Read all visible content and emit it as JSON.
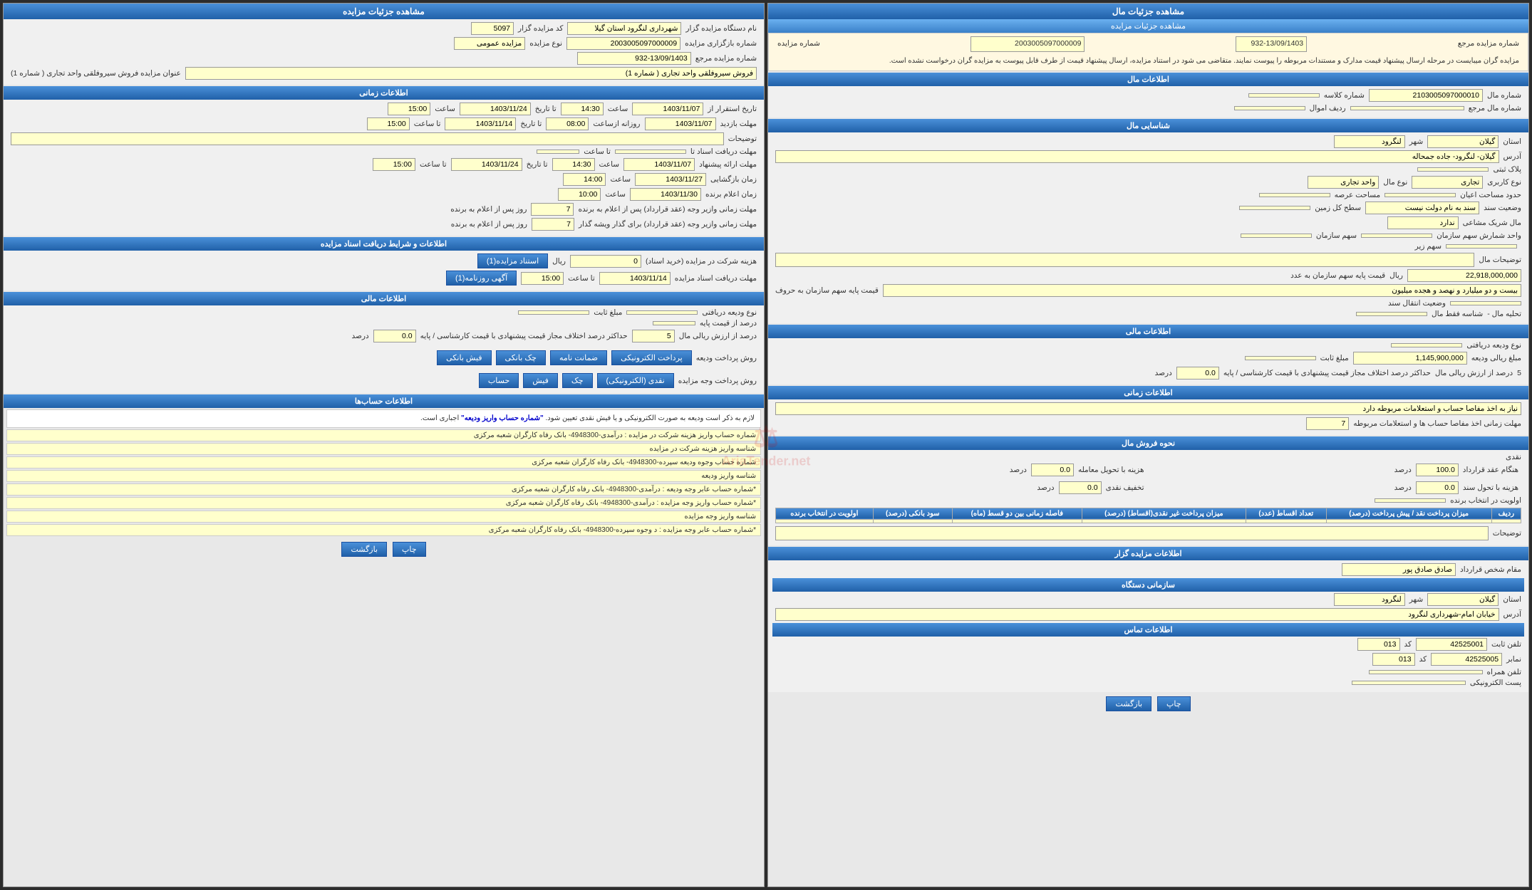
{
  "leftPanel": {
    "title": "مشاهده جزئیات مال",
    "subHeader": "مشاهده جزئیات مزایده",
    "notice": "مزایده گران میبایست در مرحله ارسال پیشنهاد قیمت مدارک و مستندات مربوطه را پیوست نمایند. متقاضی می شود در استناد مزایده، ارسال پیشنهاد قیمت از طرف قابل پیوست به مزایده گران درخواست نشده است.",
    "auctionCode": "2003005097000009",
    "auctionRef": "932-13/09/1403",
    "malInfo": {
      "sectionTitle": "اطلاعات مال",
      "malNumber": "2103005097000010",
      "malMarja": "",
      "classNumber": "",
      "redifAmval": "",
      "shenasiMali": {
        "sectionTitle": "شناسایی مال",
        "ostan": "گیلان",
        "shahr": "لنگرود",
        "address": "گیلان- لنگرود- جاده جمحاله",
        "plakSabti": "",
        "noKarbari": "تجاری",
        "noMal": "واحد تجاری",
        "hodudMosahat": "",
        "masahatArsa": "",
        "sathKolZamin": "",
        "malSharekMoshae": "ندارد",
        "vaziatSanad": "سند به نام دولت نیست",
        "vadSahmSazman": "",
        "sahmSazman": "",
        "sahmZir": "",
        "tozihatMal": "",
        "gheymatPayeSaham": "22,918,000,000",
        "gheymatUnit": "ریال",
        "payeSahamText": "بیست و دو میلیارد و نهصد و هجده میلیون",
        "vaziatEntegalSanad": "",
        "tahliyeMal": "تحلیه مال -"
      }
    },
    "maliInfo": {
      "sectionTitle": "اطلاعات مالی",
      "noeVadiye": "",
      "mablaghRialiVadiye": "1,145,900,000",
      "mablaghSabet": "",
      "darsadAzQeimat": "5",
      "haداکثرDarsad": "0.0",
      "darsadUnit": "درصد"
    },
    "zamaniInfo": {
      "sectionTitle": "اطلاعات زمانی",
      "niyazHesab": "نیاز به اخذ مفاصا حساب و استعلامات مربوطه دارد",
      "mohlatZamaniAkhdMofasa": "7"
    },
    "forushMal": {
      "sectionTitle": "نحوه فروش مال",
      "naghd": "نقدی",
      "hangramAqd": "100.0",
      "hangramBaSanad": "0.0",
      "hasngaramBaTahvilMoamele": "0.0",
      "takhfifNaqdی": "0.0",
      "avloyatEntekhabBarande": ""
    },
    "tableHeaders": [
      "ردیف",
      "میزان پرداخت نقد / پیش پرداخت (درصد)",
      "تعداد اقساط (عدد)",
      "میزان پرداخت غیر نقدی(اقساط) (درصد)",
      "فاصله زمانی بین دو قسط (ماه)",
      "سود بانکی (درصد)",
      "اولویت در انتخاب برنده"
    ],
    "tozihat": "توضیحات",
    "mazayadeGar": {
      "sectionTitle": "اطلاعات مزایده گزار",
      "moghame": "صادق صادق پور",
      "ostan": "گیلان",
      "shahr": "لنگرود",
      "address": "خیابان امام-شهرداری لنگرود",
      "temasInfo": {
        "sectionTitle": "اطلاعات تماس",
        "sabitCode": "013",
        "sabitNumber": "42525001",
        "namaberCode": "013",
        "namaberNumber": "42525005",
        "hamrah": "",
        "postElectronic": ""
      }
    },
    "buttons": {
      "chap": "چاپ",
      "bazgasht": "بازگشت"
    }
  },
  "rightPanel": {
    "title": "مشاهده جزئیات مزایده",
    "namDastgah": "شهرداری لنگرود استان گیلا",
    "kodMazayade": "5097",
    "noeMazayade": "مزایده عمومی",
    "shomareBarGozari": "2003005097000009",
    "shomareMarje": "932-13/09/1403",
    "onvanMazayade": "فروش سیروفلقی واحد تجاری ( شماره 1)",
    "zamaniInfo": {
      "sectionTitle": "اطلاعات زمانی",
      "tarikhShuru": "1403/11/07",
      "saatShuru": "14:30",
      "tarikhPayan": "1403/11/24",
      "saatPayan": "15:00",
      "mohlatBazdid": "1403/11/07",
      "saatBazdid": "08:00",
      "tarikhPayanBazdid": "1403/11/14",
      "saatPayanBazdid": "15:00",
      "tozihat": "",
      "mohlatEstenadRow1": {
        "label": "مهلت دریافت اسناد",
        "tarikhAz": "1403/11/14",
        "saatAz": "15:00",
        "tarikhTa": "",
        "saatTa": ""
      },
      "mohlatAraeRow": {
        "label": "مهلت ارائه پیشنهاد",
        "tarikhAz": "1403/11/07",
        "saatAz": "14:30",
        "tarikhTa": "1403/11/24",
        "saatTa": "15:00"
      },
      "zmanBazgoshaii": {
        "label": "زمان بازگشایی",
        "tarikh": "1403/11/27",
        "saat": "14:00"
      },
      "zamanEelamBarande": {
        "label": "زمان اعلام برنده",
        "tarikh": "1403/11/30",
        "saat": "10:00"
      },
      "mohlatZamaniVazeh": "7",
      "mohlatZamaniVazehBarande": "7"
    },
    "asnadInfo": {
      "sectionTitle": "اطلاعات و شرایط دریافت اسناد مزایده",
      "gharimatSherkat": "0",
      "gharimatUnit": "ریال",
      "btnEstadMazayade": "استناد مزایده(1)",
      "btnAgahiRozname": "آگهی روزنامه(1)",
      "mohlatDaryaftAsnad": "1403/11/14",
      "saatMohlatDaryaft": "15:00"
    },
    "maliInfo": {
      "sectionTitle": "اطلاعات مالی",
      "noeVadiye": "",
      "mablaghSabet": "",
      "darsadAzQeimatPaye": "",
      "darsadAzArzeshRiali": "5",
      "haداکثرDarsad": "0.0",
      "darsadUnit": "درصد"
    },
    "pardakhtVadiye": {
      "label": "روش پرداخت ودیعه",
      "options": [
        "پرداخت الکترونیکی",
        "ضمانت نامه",
        "چک بانکی",
        "فیش بانکی"
      ]
    },
    "pardakhtVojhMazayade": {
      "label": "روش پرداخت وجه مزایده",
      "options": [
        "نقدی (الکترونیکی)",
        "چک",
        "فیش",
        "حساب"
      ]
    },
    "hesabInfo": {
      "sectionTitle": "اطلاعات حساب‌ها",
      "descText": "لازم به ذکر است ودیعه به صورت الکترونیکی و یا فیش نقدی تعیین شود. \"شماره حساب واریز ودیعه\" اجباری است.",
      "rows": [
        "شماره حساب واریز هزینه شرکت در مزایده : درآمدی-4948300- بانک رفاه کارگران شعبه مرکزی",
        "شناسه واریز هزینه شرکت در مزایده",
        "شماره حساب وجوه ودیعه سپرده-4948300- بانک رفاه کارگران شعبه مرکزی",
        "شناسه واریز ودیعه",
        "*شماره حساب عابر وجه ودیعه : درآمدی-4948300- بانک رفاه کارگران شعبه مرکزی",
        "*شماره حساب واریز وجه مزایده : درآمدی-4948300- بانک رفاه کارگران شعبه مرکزی",
        "شناسه واریز وجه مزایده",
        "*شماره حساب عابر وجه مزایده : د وجوه سپرده-4948300- بانک رفاه کارگران شعبه مرکزی"
      ]
    },
    "buttons": {
      "chap": "چاپ",
      "bazgasht": "بازگشت"
    }
  }
}
